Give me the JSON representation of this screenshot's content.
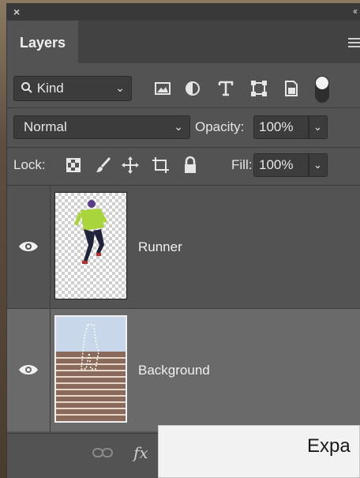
{
  "panel": {
    "close_symbol": "×",
    "collapse_symbol": "‹‹",
    "tab_label": "Layers"
  },
  "filter": {
    "kind_label": "Kind",
    "icons": [
      "pixel-filter-icon",
      "adjustment-filter-icon",
      "type-filter-icon",
      "shape-filter-icon",
      "smart-object-filter-icon"
    ]
  },
  "blend": {
    "mode": "Normal",
    "opacity_label": "Opacity:",
    "opacity_value": "100%"
  },
  "lock": {
    "label": "Lock:",
    "fill_label": "Fill:",
    "fill_value": "100%"
  },
  "layers": [
    {
      "name": "Runner",
      "visible": true,
      "selected": false
    },
    {
      "name": "Background",
      "visible": true,
      "selected": true
    }
  ],
  "footer": {
    "fx_label": "fx",
    "tooltip_text": "Expa"
  }
}
